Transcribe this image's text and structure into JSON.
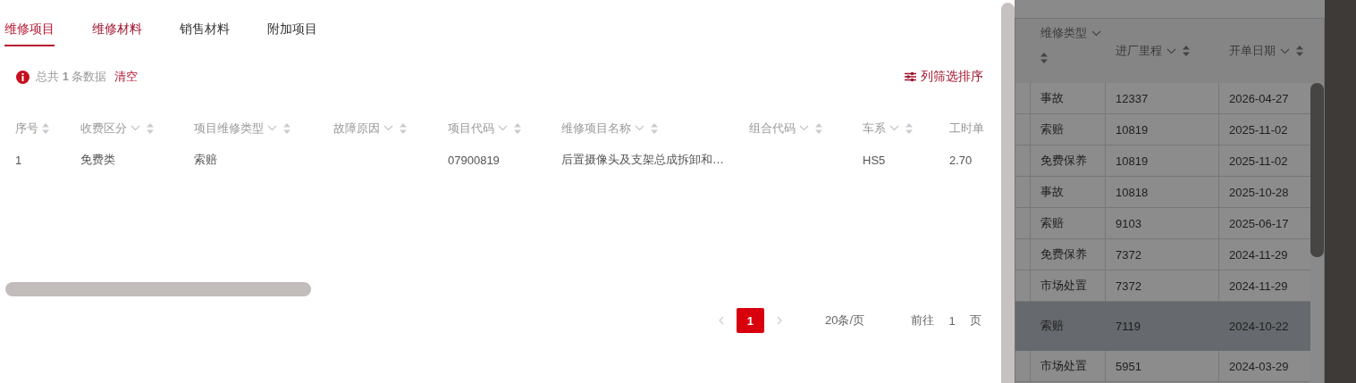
{
  "tabs": [
    {
      "label": "维修项目",
      "selected": true
    },
    {
      "label": "维修材料",
      "selected": false
    },
    {
      "label": "销售材料",
      "selected": false
    },
    {
      "label": "附加项目",
      "selected": false
    }
  ],
  "summary": {
    "text": "总共 **1** 条数据",
    "clear": "清空"
  },
  "column_settings": "列筛选排序",
  "table": {
    "columns": [
      {
        "label": "序号",
        "filter": false,
        "sort": true
      },
      {
        "label": "收费区分",
        "filter": true,
        "sort": true
      },
      {
        "label": "项目维修类型",
        "filter": true,
        "sort": true
      },
      {
        "label": "故障原因",
        "filter": true,
        "sort": true
      },
      {
        "label": "项目代码",
        "filter": true,
        "sort": true
      },
      {
        "label": "维修项目名称",
        "filter": true,
        "sort": true
      },
      {
        "label": "组合代码",
        "filter": true,
        "sort": true
      },
      {
        "label": "车系",
        "filter": true,
        "sort": true
      },
      {
        "label": "工时单"
      }
    ],
    "rows": [
      [
        "1",
        "免费类",
        "索赔",
        "",
        "07900819",
        "后置摄像头及支架总成拆卸和…",
        "",
        "HS5",
        "2.70"
      ]
    ]
  },
  "pagination": {
    "prev_disabled": true,
    "next_disabled": true,
    "pages": [
      {
        "label": "1",
        "selected": true
      }
    ],
    "page_size": "20条/页",
    "goto_label": "前往",
    "goto_value": "1",
    "goto_suffix": "页"
  },
  "background_table": {
    "columns": [
      {
        "label": "维修类型"
      },
      {
        "label": "进厂里程"
      },
      {
        "label": "开单日期"
      }
    ],
    "rows": [
      {
        "repair_type": "事故",
        "mileage": "12337",
        "date": "2026-04-27",
        "selected": false
      },
      {
        "repair_type": "索赔",
        "mileage": "10819",
        "date": "2025-11-02",
        "selected": false
      },
      {
        "repair_type": "免费保养",
        "mileage": "10819",
        "date": "2025-11-02",
        "selected": false
      },
      {
        "repair_type": "事故",
        "mileage": "10818",
        "date": "2025-10-28",
        "selected": false
      },
      {
        "repair_type": "索赔",
        "mileage": "9103",
        "date": "2025-06-17",
        "selected": false
      },
      {
        "repair_type": "免费保养",
        "mileage": "7372",
        "date": "2024-11-29",
        "selected": false
      },
      {
        "repair_type": "市场处置",
        "mileage": "7372",
        "date": "2024-11-29",
        "selected": false
      },
      {
        "repair_type": "索赔",
        "mileage": "7119",
        "date": "2024-10-22",
        "selected": true
      },
      {
        "repair_type": "市场处置",
        "mileage": "5951",
        "date": "2024-03-29",
        "selected": false
      }
    ]
  }
}
